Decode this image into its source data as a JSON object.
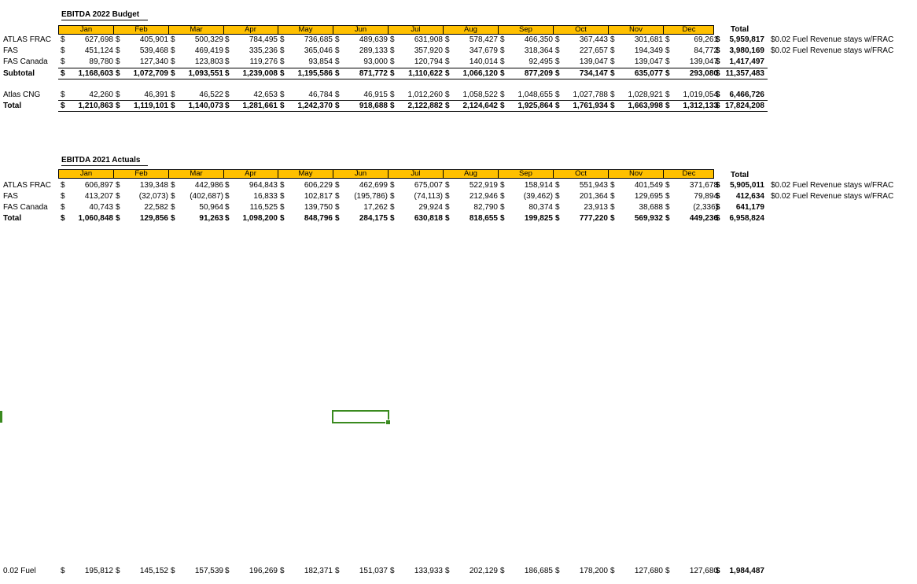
{
  "months": [
    "Jan",
    "Feb",
    "Mar",
    "Apr",
    "May",
    "Jun",
    "Jul",
    "Aug",
    "Sep",
    "Oct",
    "Nov",
    "Dec"
  ],
  "total_header": "Total",
  "budget": {
    "title": "EBITDA 2022 Budget",
    "rows": [
      {
        "label": "ATLAS FRAC",
        "values": [
          "627,698",
          "405,901",
          "500,329",
          "784,495",
          "736,685",
          "489,639",
          "631,908",
          "578,427",
          "466,350",
          "367,443",
          "301,681",
          "69,261"
        ],
        "total": "5,959,817",
        "note": "$0.02 Fuel Revenue stays w/FRAC",
        "bold": false
      },
      {
        "label": "FAS",
        "values": [
          "451,124",
          "539,468",
          "469,419",
          "335,236",
          "365,046",
          "289,133",
          "357,920",
          "347,679",
          "318,364",
          "227,657",
          "194,349",
          "84,772"
        ],
        "total": "3,980,169",
        "note": "$0.02 Fuel Revenue stays w/FRAC",
        "bold": false
      },
      {
        "label": "FAS Canada",
        "values": [
          "89,780",
          "127,340",
          "123,803",
          "119,276",
          "93,854",
          "93,000",
          "120,794",
          "140,014",
          "92,495",
          "139,047",
          "139,047",
          "139,047"
        ],
        "total": "1,417,497",
        "note": "",
        "bold": false
      },
      {
        "label": "Subtotal",
        "values": [
          "1,168,603",
          "1,072,709",
          "1,093,551",
          "1,239,008",
          "1,195,586",
          "871,772",
          "1,110,622",
          "1,066,120",
          "877,209",
          "734,147",
          "635,077",
          "293,080"
        ],
        "total": "11,357,483",
        "note": "",
        "bold": true
      },
      {
        "label": "Atlas CNG",
        "values": [
          "42,260",
          "46,391",
          "46,522",
          "42,653",
          "46,784",
          "46,915",
          "1,012,260",
          "1,058,522",
          "1,048,655",
          "1,027,788",
          "1,028,921",
          "1,019,054"
        ],
        "total": "6,466,726",
        "note": "",
        "bold": false
      },
      {
        "label": "Total",
        "values": [
          "1,210,863",
          "1,119,101",
          "1,140,073",
          "1,281,661",
          "1,242,370",
          "918,688",
          "2,122,882",
          "2,124,642",
          "1,925,864",
          "1,761,934",
          "1,663,998",
          "1,312,133"
        ],
        "total": "17,824,208",
        "note": "",
        "bold": true
      }
    ]
  },
  "actuals": {
    "title": "EBITDA 2021 Actuals",
    "rows": [
      {
        "label": "ATLAS FRAC",
        "values": [
          "606,897",
          "139,348",
          "442,986",
          "964,843",
          "606,229",
          "462,699",
          "675,007",
          "522,919",
          "158,914",
          "551,943",
          "401,549",
          "371,678"
        ],
        "total": "5,905,011",
        "note": "$0.02 Fuel Revenue stays w/FRAC",
        "bold": false
      },
      {
        "label": "FAS",
        "values": [
          "413,207",
          "(32,073)",
          "(402,687)",
          "16,833",
          "102,817",
          "(195,786)",
          "(74,113)",
          "212,946",
          "(39,462)",
          "201,364",
          "129,695",
          "79,894"
        ],
        "total": "412,634",
        "note": "$0.02 Fuel Revenue stays w/FRAC",
        "bold": false
      },
      {
        "label": "FAS Canada",
        "values": [
          "40,743",
          "22,582",
          "50,964",
          "116,525",
          "139,750",
          "17,262",
          "29,924",
          "82,790",
          "80,374",
          "23,913",
          "38,688",
          "(2,336)"
        ],
        "total": "641,179",
        "note": "",
        "bold": false
      },
      {
        "label": "Total",
        "values": [
          "1,060,848",
          "129,856",
          "91,263",
          "1,098,200",
          "848,796",
          "284,175",
          "630,818",
          "818,655",
          "199,825",
          "777,220",
          "569,932",
          "449,236"
        ],
        "total": "6,958,824",
        "note": "",
        "bold": true
      }
    ]
  },
  "fuel": {
    "label": "0.02 Fuel",
    "values": [
      "195,812",
      "145,152",
      "157,539",
      "196,269",
      "182,371",
      "151,037",
      "133,933",
      "202,129",
      "186,685",
      "178,200",
      "127,680",
      "127,680"
    ],
    "total": "1,984,487"
  },
  "currency_symbol": "$",
  "colors": {
    "header_fill": "#ffc000",
    "selection": "#3a8a1f"
  }
}
